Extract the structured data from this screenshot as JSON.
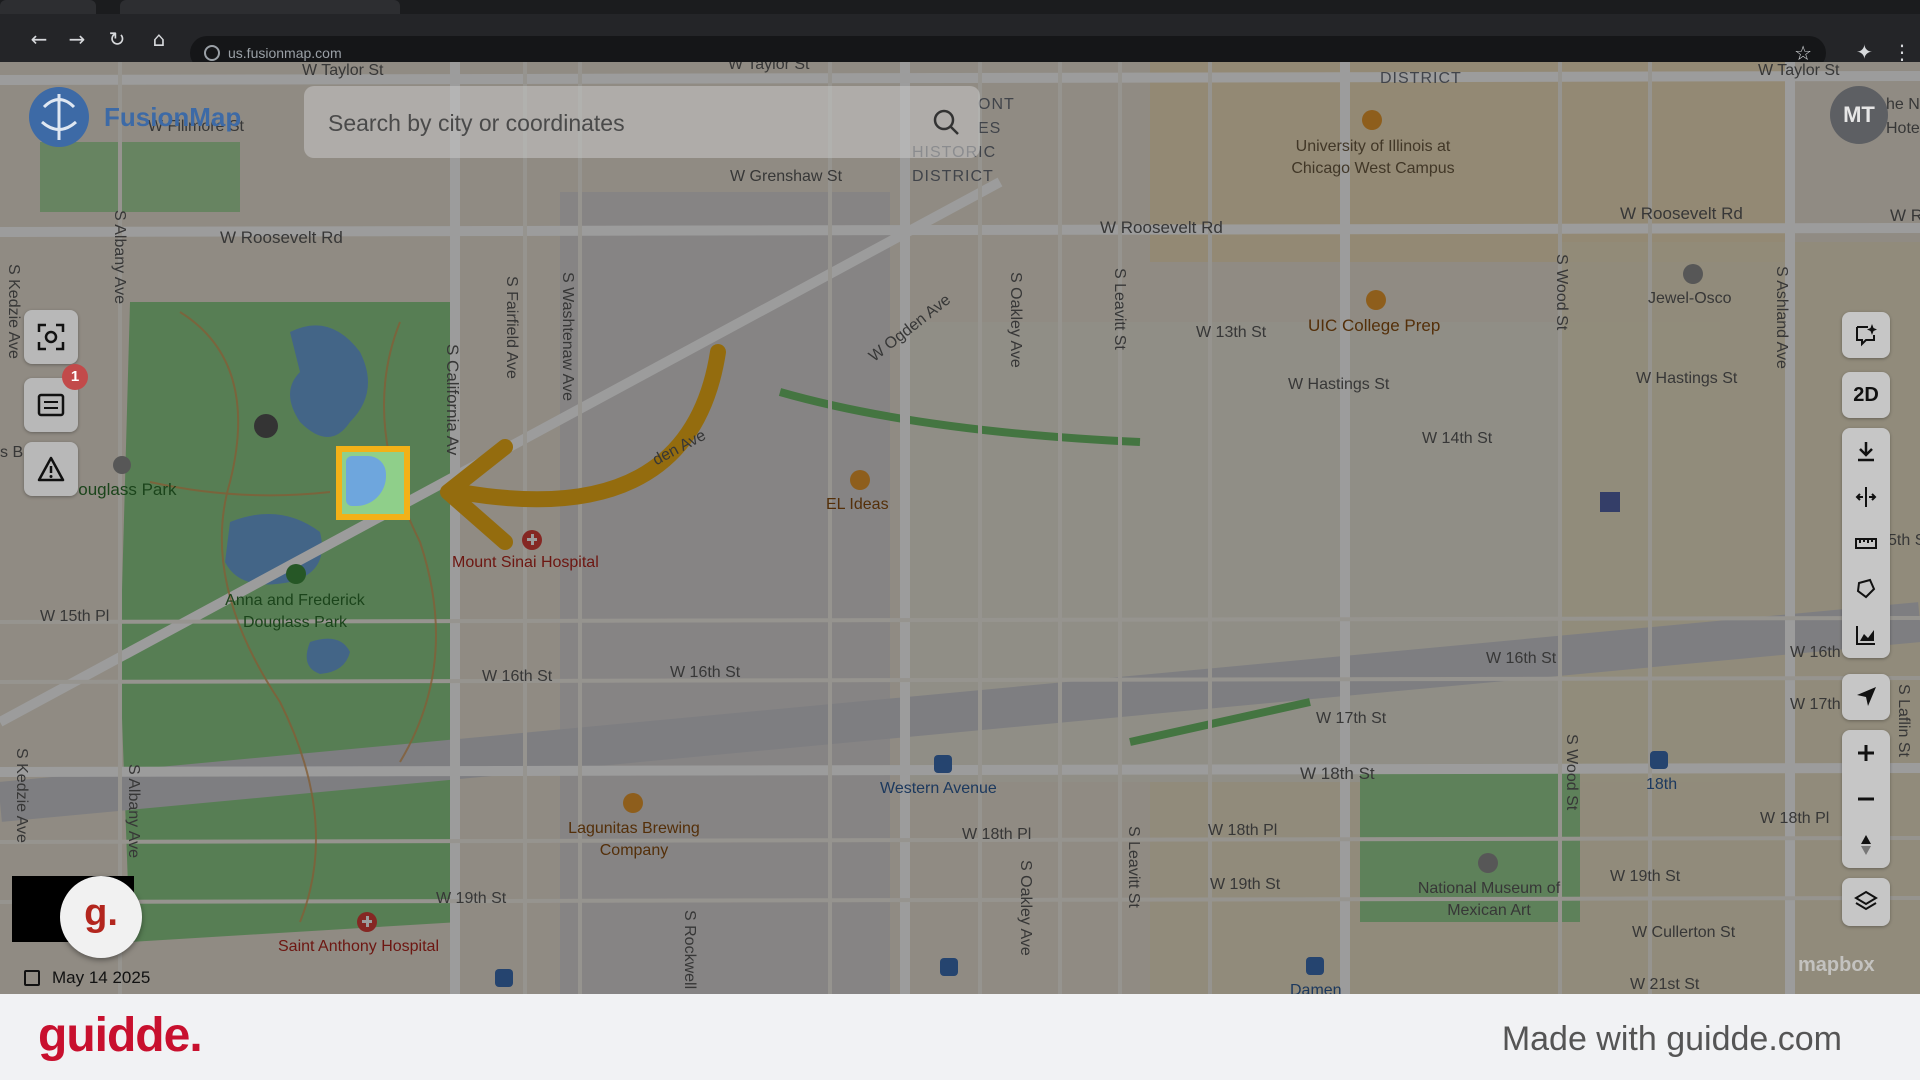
{
  "browser": {
    "url": "us.fusionmap.com",
    "icons": [
      "back-icon",
      "forward-icon",
      "reload-icon",
      "home-icon",
      "bookmark-star-icon",
      "extensions-icon",
      "menu-icon"
    ]
  },
  "app": {
    "name": "FusionMap",
    "search_placeholder": "Search by city or coordinates",
    "avatar_initials": "MT",
    "notification_count": "1",
    "view_mode": "2D",
    "date": "May 14 2025",
    "attribution": "mapbox"
  },
  "map_labels": {
    "streets": {
      "taylor_1": "W Taylor St",
      "taylor_2": "W Taylor St",
      "taylor_3": "W Taylor St",
      "fillmore": "W Fillmore St",
      "grenshaw": "W Grenshaw St",
      "roosevelt_1": "W Roosevelt Rd",
      "roosevelt_2": "W Roosevelt Rd",
      "roosevelt_3": "W Roosevelt Rd",
      "roosevelt_edge": "W R",
      "thirteenth": "W 13th St",
      "hastings_1": "W Hastings St",
      "hastings_2": "W Hastings St",
      "fourteenth": "W 14th St",
      "fifteenth_pl": "W 15th Pl",
      "sixteenth_1": "W 16th St",
      "sixteenth_2": "W 16th St",
      "sixteenth_3": "W 16th St",
      "sixteenth_4": "W 16th St",
      "seventeenth_1": "W 17th St",
      "seventeenth_2": "W 17th St",
      "eighteenth": "W 18th St",
      "eighteenth_pl_1": "W 18th Pl",
      "eighteenth_pl_2": "W 18th Pl",
      "eighteenth_pl_3": "W 18th Pl",
      "nineteenth_1": "W 19th St",
      "nineteenth_2": "W 19th St",
      "nineteenth_3": "W 19th St",
      "cullerton": "W Cullerton St",
      "twentyfirst": "W 21st St",
      "ogden_1": "W Ogden Ave",
      "ogden_2": "den Ave",
      "fifth_edge": "5th S",
      "kedzie_1": "S Kedzie Ave",
      "kedzie_2": "S Kedzie Ave",
      "albany_1": "S Albany Ave",
      "albany_2": "S Albany Ave",
      "california": "S California Av",
      "fairfield": "S Fairfield Ave",
      "washtenaw": "S Washtenaw Ave",
      "oakley_1": "S Oakley Ave",
      "oakley_2": "S Oakley Ave",
      "leavitt_1": "S Leavitt St",
      "leavitt_2": "S Leavitt St",
      "wood_1": "S Wood St",
      "wood_2": "S Wood St",
      "ashland": "S Ashland Ave",
      "laflin": "S Laflin St",
      "rockwell": "S Rockwell",
      "edge_s_b": "s B"
    },
    "places": {
      "douglass_park": "Douglass Park",
      "anna_frederick": "Anna and Frederick Douglass Park",
      "mount_sinai": "Mount Sinai Hospital",
      "saint_anthony": "Saint Anthony Hospital",
      "el_ideas": "EL Ideas",
      "lagunitas": "Lagunitas Brewing Company",
      "uic_campus": "University of Illinois at Chicago West Campus",
      "uic_prep": "UIC College Prep",
      "jewel_osco": "Jewel-Osco",
      "national_museum": "National Museum of Mexican Art",
      "western_avenue": "Western Avenue",
      "eighteenth_station": "18th",
      "damen": "Damen",
      "illinois_medical_district": "DISTRICT",
      "historic_district_1": "ONT",
      "historic_district_2": "ES",
      "historic_district_3": "HISTORIC",
      "historic_district_4": "DISTRICT",
      "hotel_edge_1": "he N",
      "hotel_edge_2": "Hotel"
    }
  },
  "footer": {
    "brand": "guidde.",
    "credit": "Made with guidde.com"
  },
  "colors": {
    "highlight": "#f2b118",
    "arrow": "#f2b118",
    "park": "#8fcf8a",
    "water": "#6ea6dd",
    "brand_red": "#c8102e"
  }
}
